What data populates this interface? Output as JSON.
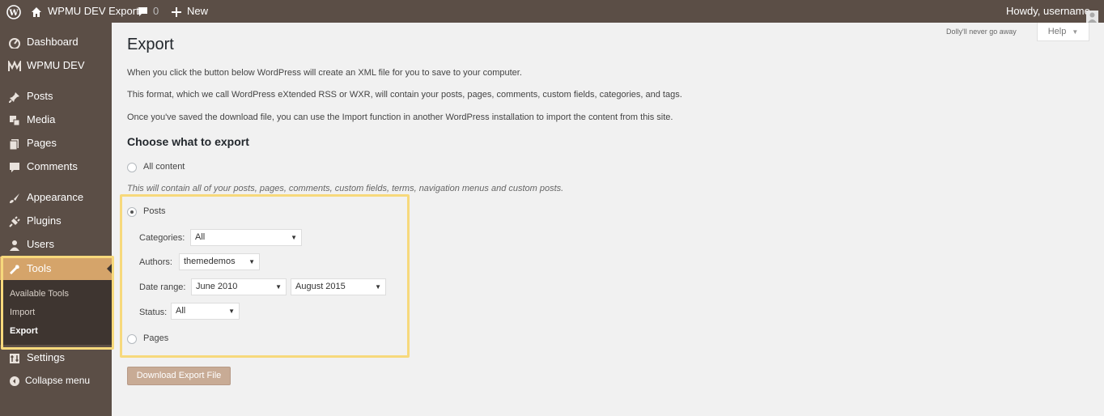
{
  "admin_bar": {
    "site_name": "WPMU DEV Export",
    "comments_count": "0",
    "new_label": "New",
    "howdy": "Howdy, username"
  },
  "sidebar": {
    "items": [
      {
        "label": "Dashboard",
        "icon": "dashboard-icon"
      },
      {
        "label": "WPMU DEV",
        "icon": "wpmudev-icon"
      },
      {
        "label": "Posts",
        "icon": "pin-icon"
      },
      {
        "label": "Media",
        "icon": "media-icon"
      },
      {
        "label": "Pages",
        "icon": "pages-icon"
      },
      {
        "label": "Comments",
        "icon": "comment-icon"
      },
      {
        "label": "Appearance",
        "icon": "brush-icon"
      },
      {
        "label": "Plugins",
        "icon": "plug-icon"
      },
      {
        "label": "Users",
        "icon": "user-icon"
      },
      {
        "label": "Tools",
        "icon": "wrench-icon"
      },
      {
        "label": "Settings",
        "icon": "settings-icon"
      },
      {
        "label": "Collapse menu",
        "icon": "collapse-icon"
      }
    ],
    "tools_submenu": [
      "Available Tools",
      "Import",
      "Export"
    ],
    "accent_color": "#d5a46a",
    "highlight_color": "#f7d97c"
  },
  "page": {
    "dolly": "Dolly'll never go away",
    "help_label": "Help",
    "title": "Export",
    "paragraphs": [
      "When you click the button below WordPress will create an XML file for you to save to your computer.",
      "This format, which we call WordPress eXtended RSS or WXR, will contain your posts, pages, comments, custom fields, categories, and tags.",
      "Once you've saved the download file, you can use the Import function in another WordPress installation to import the content from this site."
    ],
    "choose_heading": "Choose what to export",
    "all_content_label": "All content",
    "all_content_desc": "This will contain all of your posts, pages, comments, custom fields, terms, navigation menus and custom posts.",
    "posts_label": "Posts",
    "categories_label": "Categories:",
    "categories_value": "All",
    "authors_label": "Authors:",
    "authors_value": "themedemos",
    "date_range_label": "Date range:",
    "date_start": "June 2010",
    "date_end": "August 2015",
    "status_label": "Status:",
    "status_value": "All",
    "pages_label": "Pages",
    "download_button": "Download Export File"
  }
}
